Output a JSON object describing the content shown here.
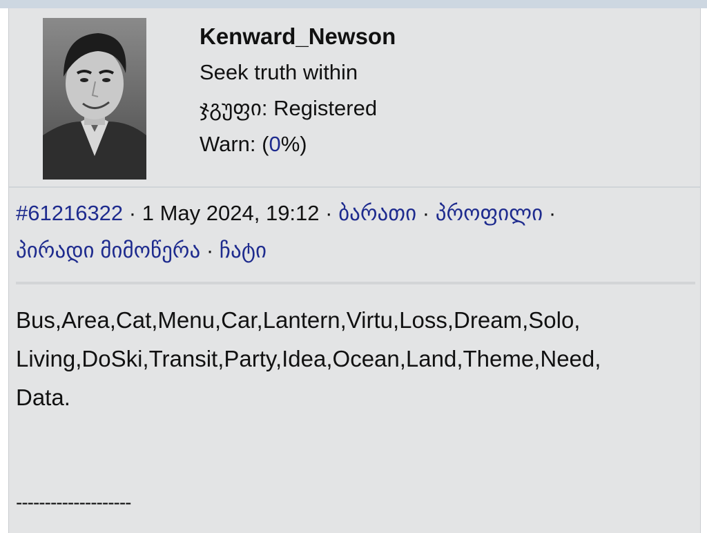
{
  "user": {
    "avatar_icon": "user-avatar-portrait",
    "username": "Kenward_Newson",
    "status_text": "Seek truth within",
    "group_label": "ჯგუფი:",
    "group_value": "Registered",
    "warn_label": "Warn: (",
    "warn_value": "0",
    "warn_suffix": "%)"
  },
  "meta": {
    "post_id": "#61216322",
    "separator": " · ",
    "datetime": "1 May 2024, 19:12",
    "links": {
      "card": "ბარათი",
      "profile": "პროფილი",
      "private_message": "პირადი მიმოწერა",
      "chat": "ჩატი"
    }
  },
  "post": {
    "body_line1": "Bus,Area,Cat,Menu,Car,Lantern,Virtu,Loss,Dream,Solo,",
    "body_line2": "Living,DoSki,Transit,Party,Idea,Ocean,Land,Theme,Need,",
    "body_line3": "Data.",
    "signature": "--------------------"
  },
  "colors": {
    "link": "#1e2b8e",
    "panel_bg": "#e3e4e5",
    "top_bar": "#cdd7e1"
  }
}
